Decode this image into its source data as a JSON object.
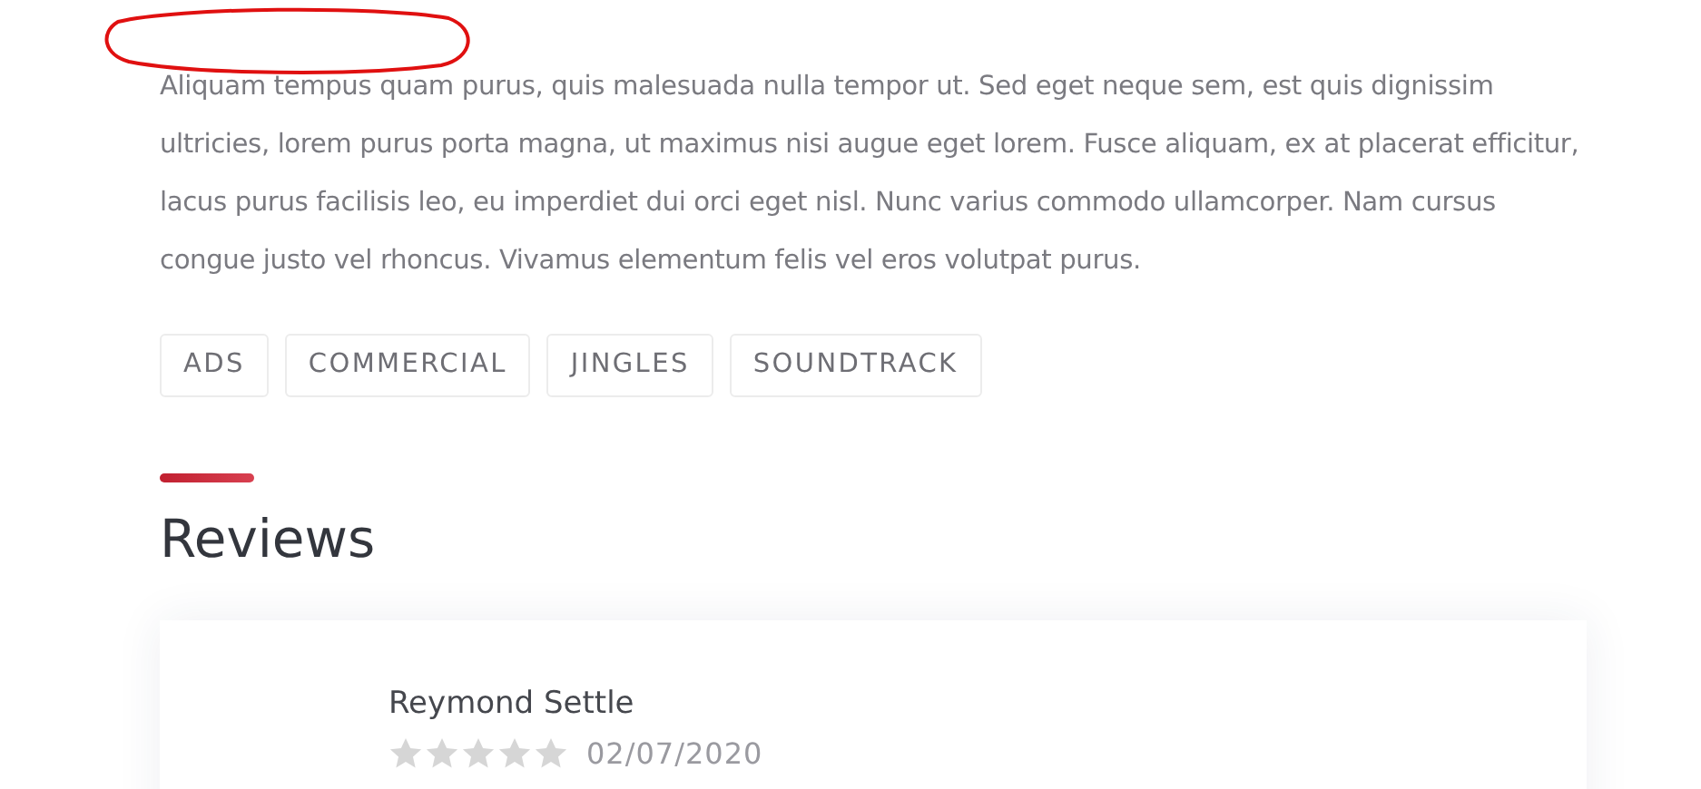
{
  "description": "Aliquam tempus quam purus, quis malesuada nulla tempor ut. Sed eget neque sem, est quis dignissim ultricies, lorem purus porta magna, ut maximus nisi augue eget lorem. Fusce aliquam, ex at placerat efficitur, lacus purus facilisis leo, eu imperdiet dui orci eget nisl. Nunc varius commodo ullamcorper. Nam cursus congue justo vel rhoncus. Vivamus elementum felis vel eros volutpat purus.",
  "tags": [
    "ADS",
    "COMMERCIAL",
    "JINGLES",
    "SOUNDTRACK"
  ],
  "reviews": {
    "title": "Reviews",
    "items": [
      {
        "name": "Reymond Settle",
        "stars": 0,
        "date": "02/07/2020"
      }
    ]
  }
}
